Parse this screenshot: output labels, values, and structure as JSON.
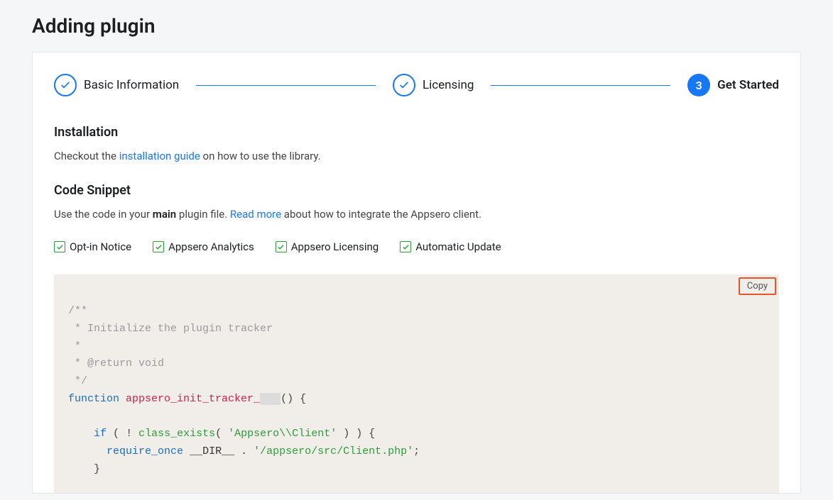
{
  "page": {
    "title": "Adding plugin"
  },
  "stepper": {
    "steps": [
      {
        "label": "Basic Information",
        "state": "done"
      },
      {
        "label": "Licensing",
        "state": "done"
      },
      {
        "label": "Get Started",
        "state": "active",
        "number": "3"
      }
    ]
  },
  "installation": {
    "heading": "Installation",
    "text_before": "Checkout the ",
    "link": "installation guide",
    "text_after": " on how to use the library."
  },
  "snippet": {
    "heading": "Code Snippet",
    "text_before": "Use the code in your ",
    "bold": "main",
    "text_mid": " plugin file. ",
    "link": "Read more",
    "text_after": " about how to integrate the Appsero client."
  },
  "checkboxes": [
    {
      "label": "Opt-in Notice",
      "checked": true
    },
    {
      "label": "Appsero Analytics",
      "checked": true
    },
    {
      "label": "Appsero Licensing",
      "checked": true
    },
    {
      "label": "Automatic Update",
      "checked": true
    }
  ],
  "code": {
    "copy_label": "Copy",
    "comment_l1": "/**",
    "comment_l2": " * Initialize the plugin tracker",
    "comment_l3": " *",
    "comment_l4": " * @return void",
    "comment_l5": " */",
    "kw_function": "function",
    "fn_name": "appsero_init_tracker_",
    "fn_name_suffix": "   ",
    "kw_if": "if",
    "fn_class_exists": "class_exists",
    "str_client_class": "'Appsero\\\\Client'",
    "kw_require": "require_once",
    "magic_dir": "__DIR__",
    "str_client_path": "'/appsero/src/Client.php'"
  }
}
